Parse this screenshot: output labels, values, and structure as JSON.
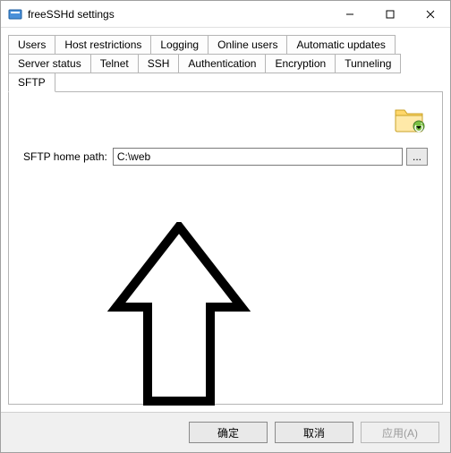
{
  "window": {
    "title": "freeSSHd settings"
  },
  "tabs_row1": [
    {
      "label": "Users"
    },
    {
      "label": "Host restrictions"
    },
    {
      "label": "Logging"
    },
    {
      "label": "Online users"
    },
    {
      "label": "Automatic updates"
    }
  ],
  "tabs_row2": [
    {
      "label": "Server status"
    },
    {
      "label": "Telnet"
    },
    {
      "label": "SSH"
    },
    {
      "label": "Authentication"
    },
    {
      "label": "Encryption"
    },
    {
      "label": "Tunneling"
    },
    {
      "label": "SFTP"
    }
  ],
  "active_tab": "SFTP",
  "sftp": {
    "home_path_label": "SFTP home path:",
    "home_path_value": "C:\\web",
    "browse_label": "..."
  },
  "buttons": {
    "ok": "确定",
    "cancel": "取消",
    "apply": "应用(A)"
  },
  "icons": {
    "folder": "folder-icon",
    "arrow_annotation": "up-arrow-annotation"
  }
}
